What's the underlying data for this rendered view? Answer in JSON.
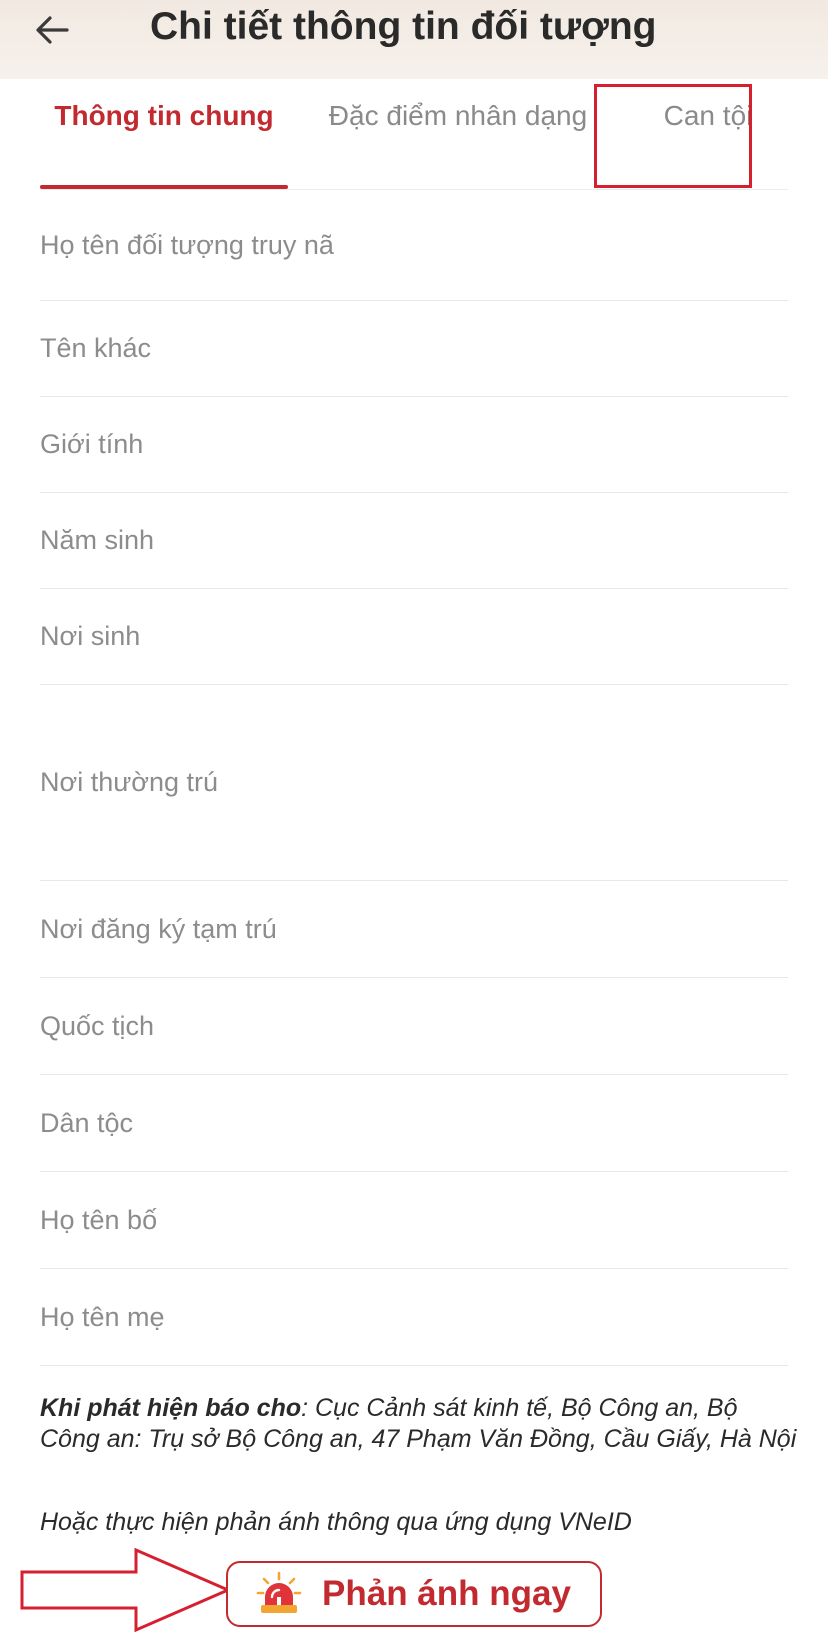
{
  "header": {
    "title": "Chi tiết thông tin đối tượng",
    "back_icon": "arrow-left-icon"
  },
  "tabs": [
    {
      "label": "Thông tin chung",
      "active": true
    },
    {
      "label": "Đặc điểm nhân dạng",
      "active": false
    },
    {
      "label": "Can tội",
      "active": false
    }
  ],
  "fields": [
    {
      "label": "Họ tên đối tượng truy nã"
    },
    {
      "label": "Tên khác"
    },
    {
      "label": "Giới tính"
    },
    {
      "label": "Năm sinh"
    },
    {
      "label": "Nơi sinh"
    },
    {
      "label": "Nơi thường trú"
    },
    {
      "label": "Nơi đăng ký tạm trú"
    },
    {
      "label": "Quốc tịch"
    },
    {
      "label": "Dân tộc"
    },
    {
      "label": "Họ tên bố"
    },
    {
      "label": "Họ tên mẹ"
    }
  ],
  "footer": {
    "report_to_label": "Khi phát hiện báo cho",
    "report_to_text": ": Cục Cảnh sát kinh tế, Bộ Công an, Bộ Công an: Trụ sở Bộ Công an, 47 Phạm Văn Đồng, Cầu Giấy, Hà Nội",
    "alt_text": "Hoặc thực hiện phản ánh thông qua ứng dụng VNeID",
    "report_button_label": "Phản ánh ngay",
    "report_button_icon": "siren-icon"
  },
  "colors": {
    "accent": "#c22a2f",
    "annotation": "#d62030",
    "header_bg": "#f3ece5",
    "muted_text": "#8c8c8c"
  }
}
